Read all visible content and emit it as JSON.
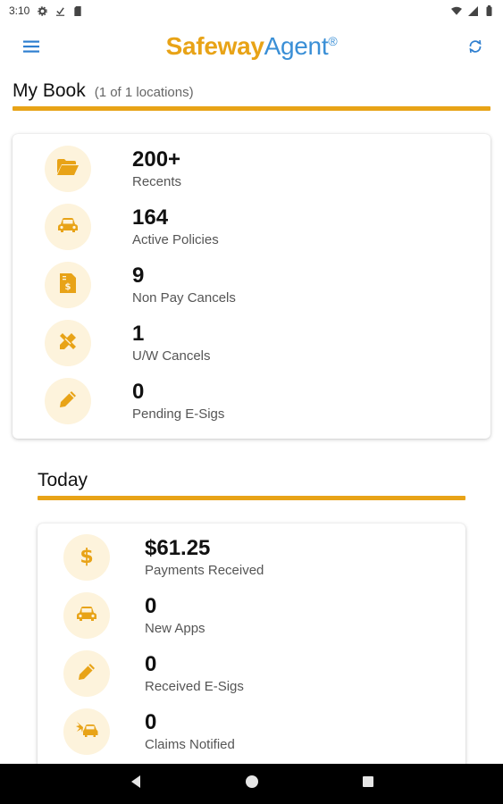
{
  "status_bar": {
    "time": "3:10"
  },
  "app": {
    "logo_part1": "Safeway",
    "logo_part2": "Agent",
    "logo_mark": "®"
  },
  "my_book": {
    "title": "My Book",
    "subtitle": "(1 of 1 locations)",
    "stats": [
      {
        "value": "200+",
        "label": "Recents",
        "icon": "folder-open-icon"
      },
      {
        "value": "164",
        "label": "Active Policies",
        "icon": "car-icon"
      },
      {
        "value": "9",
        "label": "Non Pay Cancels",
        "icon": "bill-icon"
      },
      {
        "value": "1",
        "label": "U/W Cancels",
        "icon": "pencil-ruler-icon"
      },
      {
        "value": "0",
        "label": "Pending E-Sigs",
        "icon": "pen-icon"
      }
    ]
  },
  "today": {
    "title": "Today",
    "stats": [
      {
        "value": "$61.25",
        "label": "Payments Received",
        "icon": "dollar-icon"
      },
      {
        "value": "0",
        "label": "New Apps",
        "icon": "car-icon"
      },
      {
        "value": "0",
        "label": "Received E-Sigs",
        "icon": "pen-icon"
      },
      {
        "value": "0",
        "label": "Claims Notified",
        "icon": "car-crash-icon"
      }
    ]
  },
  "colors": {
    "accent": "#e8a317",
    "brand_blue": "#3a8fd6",
    "icon_bg": "#fdf3dc"
  }
}
